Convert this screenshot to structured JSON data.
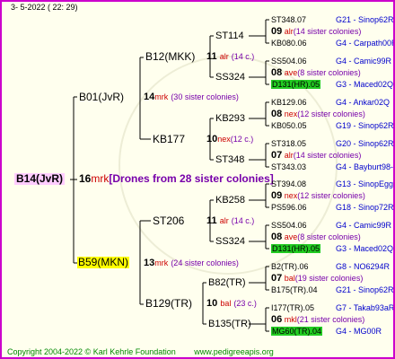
{
  "date": "3-  5-2022 (  22:  29)",
  "footer": {
    "copyright": "Copyright 2004-2022 © Karl Kehrle Foundation",
    "site": "www.pedigreeapis.org"
  },
  "root": {
    "id": "B14(JvR)",
    "num": "16",
    "mark": "mrk",
    "note": "[Drones from 28 sister colonies]"
  },
  "level1": [
    {
      "id": "B01(JvR)",
      "num": "14",
      "mark": "mrk",
      "note": "(30 sister colonies)"
    },
    {
      "id": "B59(MKN)",
      "num": "13",
      "mark": "mrk",
      "note": "(24 sister colonies)"
    }
  ],
  "level2": [
    {
      "id": "B12(MKK)",
      "num": "11",
      "mark": "alr",
      "note": "(14 c.)"
    },
    {
      "id": "KB177",
      "num": "10",
      "mark": "nex",
      "note": "(12 c.)"
    },
    {
      "id": "ST206",
      "num": "11",
      "mark": "alr",
      "note": "(14 c.)"
    },
    {
      "id": "B129(TR)",
      "num": "10",
      "mark": "bal",
      "note": "(23 c.)"
    }
  ],
  "level3": [
    {
      "id": "ST114"
    },
    {
      "id": "SS324"
    },
    {
      "id": "KB293"
    },
    {
      "id": "ST348"
    },
    {
      "id": "KB258"
    },
    {
      "id": "SS324"
    },
    {
      "id": "B82(TR)"
    },
    {
      "id": "B135(TR)"
    }
  ],
  "level4": [
    {
      "top": "ST348.07",
      "top_right": "G21 - Sinop62R",
      "num": "09",
      "mark": "alr",
      "note": "(14 sister colonies)",
      "bottom": "KB080.06",
      "bottom_right": "G4 - Carpath00R",
      "bottom_hl": false
    },
    {
      "top": "SS504.06",
      "top_right": "G4 - Camic99R",
      "num": "08",
      "mark": "ave",
      "note": "(8 sister colonies)",
      "bottom": "D131(HR).05",
      "bottom_right": "G3 - Maced02Q",
      "bottom_hl": true
    },
    {
      "top": "KB129.06",
      "top_right": "G4 - Ankar02Q",
      "num": "08",
      "mark": "nex",
      "note": "(12 sister colonies)",
      "bottom": "KB050.05",
      "bottom_right": "G19 - Sinop62R",
      "bottom_hl": false
    },
    {
      "top": "ST318.05",
      "top_right": "G20 - Sinop62R",
      "num": "07",
      "mark": "alr",
      "note": "(14 sister colonies)",
      "bottom": "ST343.03",
      "bottom_right": "G4 - Bayburt98-3",
      "bottom_hl": false
    },
    {
      "top": "ST394.08",
      "top_right": "G13 - SinopEgg86R",
      "num": "09",
      "mark": "nex",
      "note": "(12 sister colonies)",
      "bottom": "PS596.06",
      "bottom_right": "G18 - Sinop72R",
      "bottom_hl": false
    },
    {
      "top": "SS504.06",
      "top_right": "G4 - Camic99R",
      "num": "08",
      "mark": "ave",
      "note": "(8 sister colonies)",
      "bottom": "D131(HR).05",
      "bottom_right": "G3 - Maced02Q",
      "bottom_hl": true
    },
    {
      "top": "B2(TR).06",
      "top_right": "G8 - NO6294R",
      "num": "07",
      "mark": "bal",
      "note": "(19 sister colonies)",
      "bottom": "B175(TR).04",
      "bottom_right": "G21 - Sinop62R",
      "bottom_hl": false
    },
    {
      "top": "I177(TR).05",
      "top_right": "G7 - Takab93aR",
      "num": "06",
      "mark": "mkl",
      "note": "(21 sister colonies)",
      "bottom": "MG60(TR).04",
      "bottom_right": "G4 - MG00R",
      "bottom_hl": true
    }
  ]
}
